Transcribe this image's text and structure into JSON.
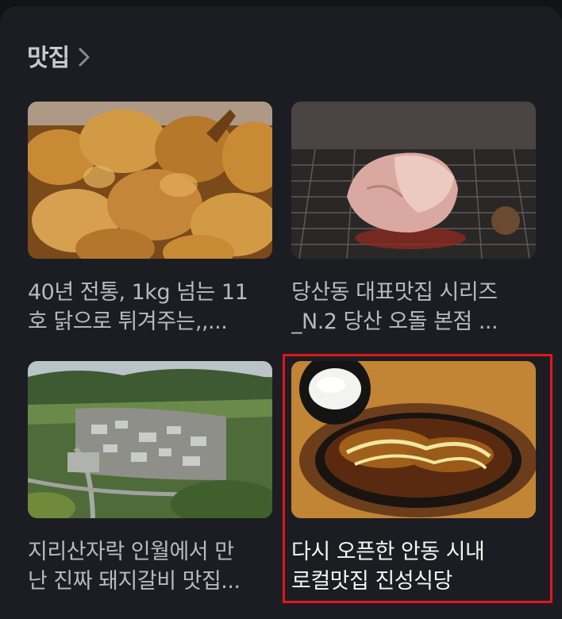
{
  "section": {
    "title": "맛집",
    "chevron_icon": "chevron-right-icon"
  },
  "items": [
    {
      "line1": "40년 전통, 1kg 넘는 11",
      "line2": "호 닭으로 튀겨주는,,...",
      "image": "fried-chicken-photo"
    },
    {
      "line1": "당산동 대표맛집 시리즈",
      "line2": "_N.2 당산 오돌 본점 ...",
      "image": "grilled-pork-photo"
    },
    {
      "line1": "지리산자락 인월에서 만",
      "line2": "난 진짜 돼지갈비 맛집...",
      "image": "aerial-village-photo"
    },
    {
      "line1": "다시 오픈한 안동 시내",
      "line2": "로컬맛집 진성식당",
      "image": "sizzling-plate-photo"
    }
  ],
  "colors": {
    "background": "#1c1d22",
    "highlight": "#e0161b"
  }
}
